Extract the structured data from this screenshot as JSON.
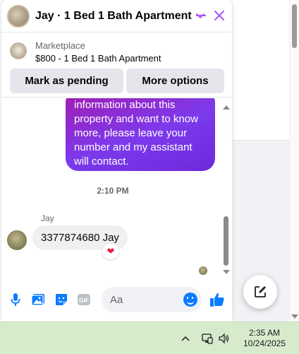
{
  "chat": {
    "title": "Jay · 1 Bed 1 Bath Apartment",
    "marketplace": {
      "label": "Marketplace",
      "listing": "$800 - 1 Bed 1 Bath Apartment",
      "pending_button": "Mark as pending",
      "more_button": "More options"
    },
    "messages": {
      "outgoing_text": "information about this property and want to know more, please leave your number and my assistant will contact.",
      "time_separator": "2:10 PM",
      "sender_name": "Jay",
      "incoming_text": "3377874680 Jay",
      "reaction": "❤"
    },
    "composer": {
      "placeholder": "Aa"
    },
    "colors": {
      "accent": "#a855f7",
      "bubble_gradient_start": "#a21caf",
      "bubble_gradient_end": "#6d28d9",
      "composer_icon": "#0a7cff"
    }
  },
  "taskbar": {
    "time": "2:35 AM",
    "date": "10/24/2025",
    "icons": [
      "chevron-up-icon",
      "network-icon",
      "volume-icon"
    ]
  }
}
